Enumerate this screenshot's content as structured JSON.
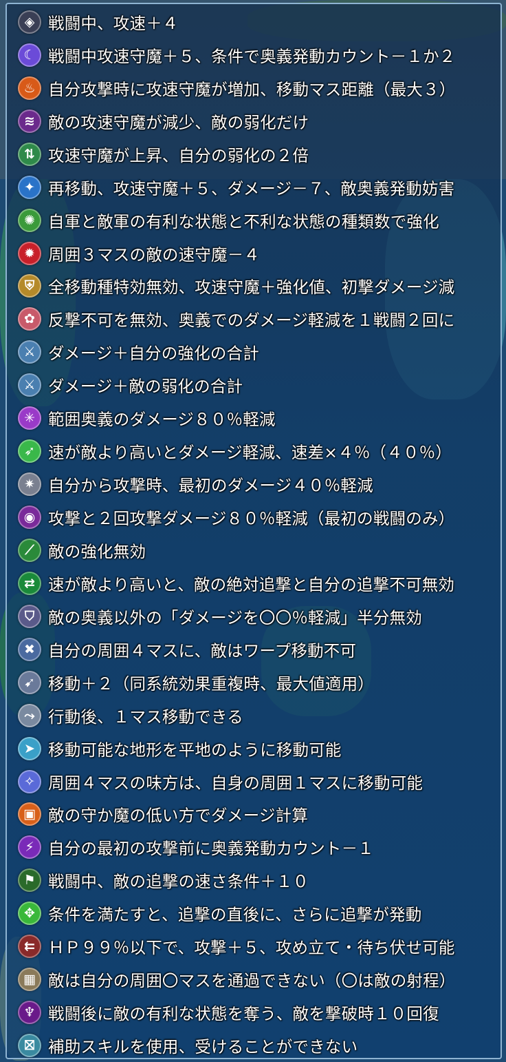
{
  "skills": [
    {
      "icon": "diamond-arrow-icon",
      "text": "戦闘中、攻速＋４",
      "color": "#3a3f55"
    },
    {
      "icon": "moon-swirl-icon",
      "text": "戦闘中攻速守魔＋５、条件で奥義発動カウント－１か２",
      "color": "#6b4bd8"
    },
    {
      "icon": "flame-icon",
      "text": "自分攻撃時に攻速守魔が増加、移動マス距離（最大３）",
      "color": "#d85a18"
    },
    {
      "icon": "purple-waves-icon",
      "text": "敵の攻速守魔が減少、敵の弱化だけ",
      "color": "#6b2a8c"
    },
    {
      "icon": "buff-arrows-icon",
      "text": "攻速守魔が上昇、自分の弱化の２倍",
      "color": "#2f8a4a"
    },
    {
      "icon": "blue-star-icon",
      "text": "再移動、攻速守魔＋５、ダメージ－７、敵奥義発動妨害",
      "color": "#2a73c8"
    },
    {
      "icon": "rainbow-swirl-icon",
      "text": "自軍と敵軍の有利な状態と不利な状態の種類数で強化",
      "color": "#3a9a3a"
    },
    {
      "icon": "red-beast-icon",
      "text": "周囲３マスの敵の速守魔－４",
      "color": "#c8202a"
    },
    {
      "icon": "golden-shield-icon",
      "text": "全移動種特効無効、攻速守魔＋強化値、初撃ダメージ減",
      "color": "#b58a2a"
    },
    {
      "icon": "pink-seal-icon",
      "text": "反撃不可を無効、奥義でのダメージ軽減を１戦闘２回に",
      "color": "#c85a6a"
    },
    {
      "icon": "sword-up-icon",
      "text": "ダメージ＋自分の強化の合計",
      "color": "#4a7fb0"
    },
    {
      "icon": "sword-down-icon",
      "text": "ダメージ＋敵の弱化の合計",
      "color": "#4a7fb0"
    },
    {
      "icon": "magic-burst-icon",
      "text": "範囲奥義のダメージ８０％軽減",
      "color": "#9a3ac8"
    },
    {
      "icon": "runner-icon",
      "text": "速が敵より高いとダメージ軽減、速差×４％（４０％）",
      "color": "#3ab84a"
    },
    {
      "icon": "shield-spark-icon",
      "text": "自分から攻撃時、最初のダメージ４０％軽減",
      "color": "#7a8090"
    },
    {
      "icon": "dark-orb-icon",
      "text": "攻撃と２回攻撃ダメージ８０％軽減（最初の戦闘のみ）",
      "color": "#7a2a9a"
    },
    {
      "icon": "green-slash-icon",
      "text": "敵の強化無効",
      "color": "#2a8a3a"
    },
    {
      "icon": "red-arrow-eye-icon",
      "text": "速が敵より高いと、敵の絶対追撃と自分の追撃不可無効",
      "color": "#1a8a3a"
    },
    {
      "icon": "shield-mark-icon",
      "text": "敵の奥義以外の「ダメージを〇〇％軽減」半分無効",
      "color": "#5a5a8a"
    },
    {
      "icon": "warp-block-icon",
      "text": "自分の周囲４マスに、敵はワープ移動不可",
      "color": "#4a6aa0"
    },
    {
      "icon": "boot-icon",
      "text": "移動＋２（同系統効果重複時、最大値適用）",
      "color": "#6a7a9a"
    },
    {
      "icon": "canto-icon",
      "text": "行動後、１マス移動できる",
      "color": "#7a8aa0"
    },
    {
      "icon": "terrain-move-icon",
      "text": "移動可能な地形を平地のように移動可能",
      "color": "#3aa0c8"
    },
    {
      "icon": "ally-warp-icon",
      "text": "周囲４マスの味方は、自身の周囲１マスに移動可能",
      "color": "#5a6ad8"
    },
    {
      "icon": "orange-square-icon",
      "text": "敵の守か魔の低い方でダメージ計算",
      "color": "#d8601a"
    },
    {
      "icon": "purple-wand-icon",
      "text": "自分の最初の攻撃前に奥義発動カウント－１",
      "color": "#7a2ab8"
    },
    {
      "icon": "red-runner-icon",
      "text": "戦闘中、敵の追撃の速さ条件＋１０",
      "color": "#2a6a2a"
    },
    {
      "icon": "green-compass-icon",
      "text": "条件を満たすと、追撃の直後に、さらに追撃が発動",
      "color": "#3ab83a"
    },
    {
      "icon": "red-arrows-icon",
      "text": "ＨＰ９９％以下で、攻撃＋５、攻め立て・待ち伏せ可能",
      "color": "#8a2a2a"
    },
    {
      "icon": "brick-wall-icon",
      "text": "敵は自分の周囲〇マスを通過できない（〇は敵の射程）",
      "color": "#8a7a5a"
    },
    {
      "icon": "purple-flame-icon",
      "text": "戦闘後に敵の有利な状態を奪う、敵を撃破時１０回復",
      "color": "#6a1a8a"
    },
    {
      "icon": "assist-block-icon",
      "text": "補助スキルを使用、受けることができない",
      "color": "#3a8aa0"
    }
  ]
}
